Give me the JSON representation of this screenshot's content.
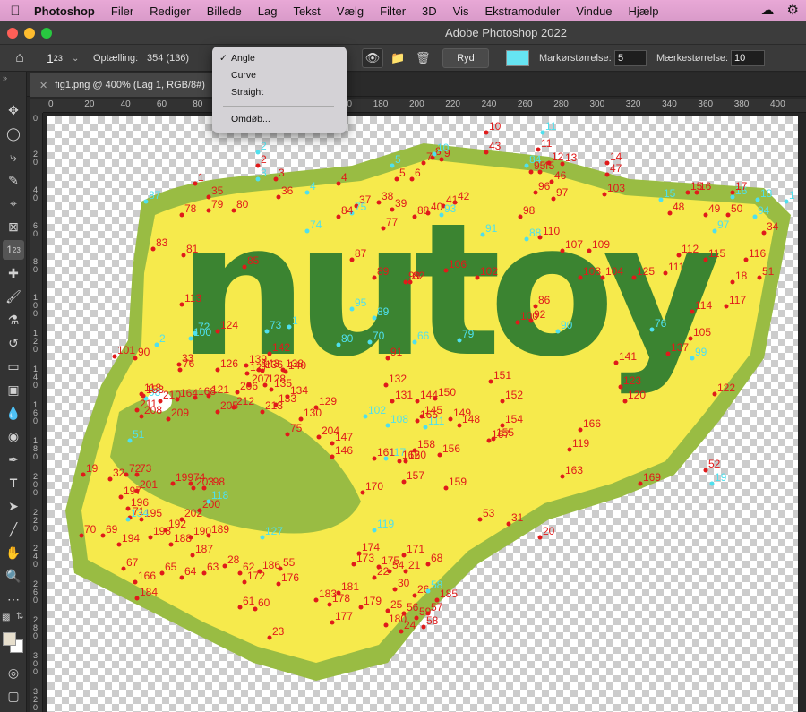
{
  "menubar": {
    "apple_icon": "apple-icon",
    "items": [
      "Photoshop",
      "Filer",
      "Rediger",
      "Billede",
      "Lag",
      "Tekst",
      "Vælg",
      "Filter",
      "3D",
      "Vis",
      "Ekstramoduler",
      "Vindue",
      "Hjælp"
    ],
    "right_icons": [
      "creative-cloud-icon",
      "extension-icon"
    ]
  },
  "window": {
    "title": "Adobe Photoshop 2022"
  },
  "options": {
    "tool_preset_icon": "count-tool-icon",
    "count_label": "Optælling:",
    "count_value": "354 (136)",
    "clear_label": "Ryd",
    "marker_color": "#66e4f2",
    "marker_size_label": "Markørstørrelse:",
    "marker_size_value": "5",
    "label_size_label": "Mærkestørrelse:",
    "label_size_value": "10"
  },
  "dropdown": {
    "selected": "Angle",
    "items": [
      "Angle",
      "Curve",
      "Straight"
    ],
    "rename_label": "Omdøb..."
  },
  "document_tab": {
    "title": "fig1.png @ 400% (Lag 1, RGB/8#)"
  },
  "tools": [
    "move-tool-icon",
    "marquee-tool-icon",
    "lasso-tool-icon",
    "quick-select-icon",
    "crop-tool-icon",
    "frame-tool-icon",
    "count-tool-icon",
    "healing-brush-icon",
    "brush-tool-icon",
    "stamp-tool-icon",
    "history-brush-icon",
    "eraser-tool-icon",
    "gradient-tool-icon",
    "blur-tool-icon",
    "dodge-tool-icon",
    "pen-tool-icon",
    "type-tool-icon",
    "path-select-icon",
    "line-tool-icon",
    "hand-tool-icon",
    "zoom-tool-icon",
    "more-tools-icon"
  ],
  "rulers": {
    "top": [
      "0",
      "20",
      "40",
      "60",
      "80",
      "100",
      "120",
      "140",
      "160",
      "180",
      "200",
      "220",
      "240",
      "260",
      "280",
      "300",
      "320",
      "340",
      "360",
      "380",
      "400"
    ],
    "left": [
      "0",
      "2 0",
      "4 0",
      "6 0",
      "8 0",
      "1 0 0",
      "1 2 0",
      "1 4 0",
      "1 6 0",
      "1 8 0",
      "2 0 0",
      "2 2 0",
      "2 4 0",
      "2 6 0",
      "2 8 0",
      "3 0 0",
      "3 2 0"
    ]
  },
  "colors": {
    "marker_red": "#e01a1a",
    "marker_cyan": "#4fe0ee",
    "logo_outer": "#99bc43",
    "logo_inner": "#f6ea4c",
    "logo_letters": "#3b8431"
  },
  "canvas": {
    "logo_text": "nutoy",
    "markers": [
      [
        "10",
        "r"
      ],
      [
        "11",
        "c"
      ],
      [
        "11",
        "r"
      ],
      [
        "12",
        "r"
      ],
      [
        "13",
        "r"
      ],
      [
        "14",
        "r"
      ],
      [
        "1",
        "r"
      ],
      [
        "2",
        "c"
      ],
      [
        "2",
        "r"
      ],
      [
        "3",
        "c"
      ],
      [
        "3",
        "r"
      ],
      [
        "4",
        "c"
      ],
      [
        "4",
        "r"
      ],
      [
        "5",
        "c"
      ],
      [
        "5",
        "r"
      ],
      [
        "6",
        "r"
      ],
      [
        "7",
        "r"
      ],
      [
        "8",
        "r"
      ],
      [
        "9",
        "r"
      ],
      [
        "10",
        "c"
      ],
      [
        "43",
        "r"
      ],
      [
        "95",
        "r"
      ],
      [
        "84",
        "c"
      ],
      [
        "47",
        "r"
      ],
      [
        "35",
        "r"
      ],
      [
        "36",
        "r"
      ],
      [
        "37",
        "r"
      ],
      [
        "38",
        "r"
      ],
      [
        "39",
        "r"
      ],
      [
        "40",
        "r"
      ],
      [
        "41",
        "r"
      ],
      [
        "42",
        "r"
      ],
      [
        "45",
        "r"
      ],
      [
        "46",
        "r"
      ],
      [
        "96",
        "r"
      ],
      [
        "97",
        "r"
      ],
      [
        "103",
        "r"
      ],
      [
        "15",
        "c"
      ],
      [
        "15",
        "r"
      ],
      [
        "16",
        "r"
      ],
      [
        "16",
        "c"
      ],
      [
        "17",
        "r"
      ],
      [
        "18",
        "c"
      ],
      [
        "1",
        "c"
      ],
      [
        "87",
        "c"
      ],
      [
        "78",
        "r"
      ],
      [
        "79",
        "r"
      ],
      [
        "80",
        "r"
      ],
      [
        "75",
        "c"
      ],
      [
        "74",
        "c"
      ],
      [
        "84",
        "r"
      ],
      [
        "77",
        "r"
      ],
      [
        "88",
        "r"
      ],
      [
        "93",
        "c"
      ],
      [
        "91",
        "c"
      ],
      [
        "88",
        "c"
      ],
      [
        "98",
        "r"
      ],
      [
        "48",
        "r"
      ],
      [
        "49",
        "r"
      ],
      [
        "50",
        "r"
      ],
      [
        "94",
        "c"
      ],
      [
        "97",
        "c"
      ],
      [
        "34",
        "r"
      ],
      [
        "83",
        "r"
      ],
      [
        "81",
        "r"
      ],
      [
        "85",
        "r"
      ],
      [
        "87",
        "r"
      ],
      [
        "89",
        "r"
      ],
      [
        "99",
        "r"
      ],
      [
        "102",
        "r"
      ],
      [
        "106",
        "r"
      ],
      [
        "110",
        "r"
      ],
      [
        "107",
        "r"
      ],
      [
        "109",
        "r"
      ],
      [
        "108",
        "r"
      ],
      [
        "104",
        "r"
      ],
      [
        "125",
        "r"
      ],
      [
        "111",
        "r"
      ],
      [
        "112",
        "r"
      ],
      [
        "115",
        "r"
      ],
      [
        "116",
        "r"
      ],
      [
        "51",
        "r"
      ],
      [
        "18",
        "r"
      ],
      [
        "117",
        "r"
      ],
      [
        "114",
        "r"
      ],
      [
        "113",
        "r"
      ],
      [
        "95",
        "c"
      ],
      [
        "82",
        "r"
      ],
      [
        "86",
        "r"
      ],
      [
        "92",
        "r"
      ],
      [
        "100",
        "r"
      ],
      [
        "89",
        "c"
      ],
      [
        "90",
        "c"
      ],
      [
        "76",
        "c"
      ],
      [
        "105",
        "r"
      ],
      [
        "124",
        "r"
      ],
      [
        "100",
        "c"
      ],
      [
        "72",
        "c"
      ],
      [
        "73",
        "c"
      ],
      [
        "1",
        "c"
      ],
      [
        "2",
        "c"
      ],
      [
        "70",
        "c"
      ],
      [
        "66",
        "c"
      ],
      [
        "80",
        "c"
      ],
      [
        "79",
        "c"
      ],
      [
        "91",
        "r"
      ],
      [
        "101",
        "r"
      ],
      [
        "90",
        "r"
      ],
      [
        "33",
        "r"
      ],
      [
        "76",
        "r"
      ],
      [
        "126",
        "r"
      ],
      [
        "127",
        "r"
      ],
      [
        "136",
        "r"
      ],
      [
        "138",
        "r"
      ],
      [
        "140",
        "r"
      ],
      [
        "142",
        "r"
      ],
      [
        "143",
        "r"
      ],
      [
        "139",
        "r"
      ],
      [
        "141",
        "r"
      ],
      [
        "137",
        "r"
      ],
      [
        "99",
        "c"
      ],
      [
        "123",
        "r"
      ],
      [
        "122",
        "r"
      ],
      [
        "120",
        "r"
      ],
      [
        "118",
        "r"
      ],
      [
        "121",
        "r"
      ],
      [
        "98",
        "c"
      ],
      [
        "206",
        "r"
      ],
      [
        "207",
        "r"
      ],
      [
        "128",
        "r"
      ],
      [
        "135",
        "r"
      ],
      [
        "134",
        "r"
      ],
      [
        "132",
        "r"
      ],
      [
        "131",
        "r"
      ],
      [
        "144",
        "r"
      ],
      [
        "150",
        "r"
      ],
      [
        "151",
        "r"
      ],
      [
        "152",
        "r"
      ],
      [
        "153",
        "r"
      ],
      [
        "168",
        "r"
      ],
      [
        "164",
        "r"
      ],
      [
        "210",
        "r"
      ],
      [
        "209",
        "r"
      ],
      [
        "208",
        "r"
      ],
      [
        "211",
        "r"
      ],
      [
        "212",
        "r"
      ],
      [
        "205",
        "r"
      ],
      [
        "213",
        "r"
      ],
      [
        "133",
        "r"
      ],
      [
        "129",
        "r"
      ],
      [
        "130",
        "r"
      ],
      [
        "102",
        "c"
      ],
      [
        "108",
        "c"
      ],
      [
        "111",
        "c"
      ],
      [
        "145",
        "r"
      ],
      [
        "148",
        "r"
      ],
      [
        "149",
        "r"
      ],
      [
        "154",
        "r"
      ],
      [
        "155",
        "r"
      ],
      [
        "167",
        "r"
      ],
      [
        "165",
        "r"
      ],
      [
        "166",
        "r"
      ],
      [
        "119",
        "r"
      ],
      [
        "51",
        "c"
      ],
      [
        "75",
        "r"
      ],
      [
        "204",
        "r"
      ],
      [
        "146",
        "r"
      ],
      [
        "147",
        "r"
      ],
      [
        "117",
        "c"
      ],
      [
        "161",
        "r"
      ],
      [
        "162",
        "r"
      ],
      [
        "160",
        "r"
      ],
      [
        "158",
        "r"
      ],
      [
        "156",
        "r"
      ],
      [
        "157",
        "r"
      ],
      [
        "159",
        "r"
      ],
      [
        "163",
        "r"
      ],
      [
        "169",
        "r"
      ],
      [
        "52",
        "r"
      ],
      [
        "19",
        "c"
      ],
      [
        "19",
        "r"
      ],
      [
        "32",
        "r"
      ],
      [
        "72",
        "r"
      ],
      [
        "73",
        "r"
      ],
      [
        "74",
        "r"
      ],
      [
        "200",
        "r"
      ],
      [
        "203",
        "r"
      ],
      [
        "199",
        "r"
      ],
      [
        "198",
        "r"
      ],
      [
        "201",
        "r"
      ],
      [
        "197",
        "r"
      ],
      [
        "71",
        "r"
      ],
      [
        "196",
        "r"
      ],
      [
        "195",
        "r"
      ],
      [
        "134",
        "c"
      ],
      [
        "202",
        "r"
      ],
      [
        "118",
        "c"
      ],
      [
        "170",
        "r"
      ],
      [
        "53",
        "r"
      ],
      [
        "20",
        "r"
      ],
      [
        "31",
        "r"
      ],
      [
        "70",
        "r"
      ],
      [
        "69",
        "r"
      ],
      [
        "194",
        "r"
      ],
      [
        "193",
        "r"
      ],
      [
        "192",
        "r"
      ],
      [
        "188",
        "r"
      ],
      [
        "189",
        "r"
      ],
      [
        "190",
        "r"
      ],
      [
        "187",
        "r"
      ],
      [
        "127",
        "c"
      ],
      [
        "119",
        "c"
      ],
      [
        "174",
        "r"
      ],
      [
        "171",
        "r"
      ],
      [
        "173",
        "r"
      ],
      [
        "175",
        "r"
      ],
      [
        "54",
        "r"
      ],
      [
        "21",
        "r"
      ],
      [
        "68",
        "r"
      ],
      [
        "67",
        "r"
      ],
      [
        "166",
        "r"
      ],
      [
        "65",
        "r"
      ],
      [
        "64",
        "r"
      ],
      [
        "63",
        "r"
      ],
      [
        "28",
        "r"
      ],
      [
        "62",
        "r"
      ],
      [
        "186",
        "r"
      ],
      [
        "172",
        "r"
      ],
      [
        "176",
        "r"
      ],
      [
        "55",
        "r"
      ],
      [
        "22",
        "r"
      ],
      [
        "30",
        "r"
      ],
      [
        "26",
        "r"
      ],
      [
        "58",
        "c"
      ],
      [
        "185",
        "r"
      ],
      [
        "184",
        "r"
      ],
      [
        "61",
        "r"
      ],
      [
        "60",
        "r"
      ],
      [
        "183",
        "r"
      ],
      [
        "181",
        "r"
      ],
      [
        "178",
        "r"
      ],
      [
        "177",
        "r"
      ],
      [
        "179",
        "r"
      ],
      [
        "25",
        "r"
      ],
      [
        "180",
        "r"
      ],
      [
        "56",
        "r"
      ],
      [
        "24",
        "r"
      ],
      [
        "59",
        "r"
      ],
      [
        "58",
        "r"
      ],
      [
        "57",
        "r"
      ],
      [
        "23",
        "r"
      ]
    ]
  }
}
